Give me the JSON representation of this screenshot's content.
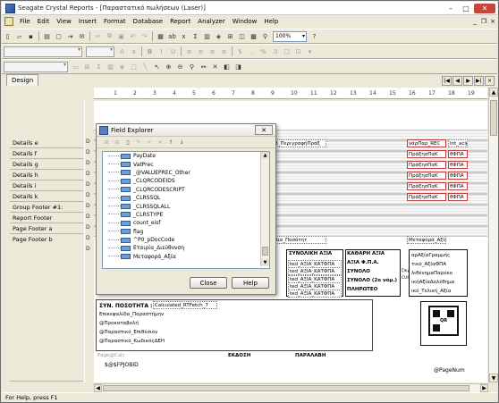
{
  "window": {
    "title": "Seagate Crystal Reports - [Παραστατικό πωλήσεων (Laser)]",
    "min": "–",
    "max": "□",
    "close": "✕"
  },
  "menu": [
    "File",
    "Edit",
    "View",
    "Insert",
    "Format",
    "Database",
    "Report",
    "Analyzer",
    "Window",
    "Help"
  ],
  "mdi": {
    "min": "_",
    "restore": "❐",
    "close": "×"
  },
  "toolbar": {
    "zoom": "100%",
    "icon_names": [
      "new-icon",
      "open-icon",
      "save-icon",
      "print-icon",
      "preview-icon",
      "export-icon",
      "mail-icon",
      "cut-icon",
      "copy-icon",
      "paste-icon",
      "undo-icon",
      "redo-icon",
      "database-icon",
      "text-object-icon",
      "formula-icon",
      "sum-icon",
      "chart-icon",
      "map-icon",
      "subreport-icon",
      "olap-icon",
      "picture-icon",
      "search-icon",
      "zoom-icon",
      "help-icon"
    ]
  },
  "tabs": {
    "design": "Design"
  },
  "tab_nav": {
    "first": "|◀",
    "prev": "◀",
    "next": "▶",
    "last": "▶|",
    "close": "×"
  },
  "sections": [
    "Details e",
    "Details f",
    "Details g",
    "Details h",
    "Details i",
    "Details k",
    "Group Footer #1:",
    "Report Footer",
    "Page Footer a",
    "Page Footer b"
  ],
  "gutter_marks": [
    "D",
    "D",
    "D",
    "D",
    "D",
    "D",
    "D",
    "D",
    "D",
    "D",
    "D"
  ],
  "ruler_ticks": [
    "1",
    "2",
    "3",
    "4",
    "5",
    "6",
    "7",
    "8",
    "9",
    "10",
    "11",
    "12",
    "13",
    "14",
    "15",
    "16",
    "17",
    "18",
    "19"
  ],
  "canvas": {
    "fields_top": [
      "Β_ΠεριγραφήΠράξ",
      "νάρΠαρ_REC",
      "Int_асір",
      "ΠράξησΠαΚ",
      "θΦΠΑ",
      "Δια_Ποσότητ",
      "Μεταφορά_Αξία"
    ],
    "totals_header": "ΣΥΝΟΛΙΚΗ ΑΞΙΑ",
    "totals_cells": [
      "ted_ΑΞΙΑ_ΚΑΤΦΠΑ",
      "ted_ΑΞΙΑ_ΚΑΤΦΠΑ",
      "ted_ΑΞΙΑ_ΚΑΤΦΠΑ",
      "ted_ΑΞΙΑ_ΚΑΤΦΠΑ",
      "ted_ΑΞΙΑ_ΚΑΤΦΠΑ"
    ],
    "labels_right": [
      "ΚΑΘΑΡΗ ΑΞΙΑ",
      "ΑΞΙΑ Φ.Π.Α.",
      "ΣΥΝΟΛΟ",
      "ΣΥΝΟΛΟ (2o νόμ.)",
      "ΠΛΗΡΩΤΕΟ"
    ],
    "side_small": [
      "ζπιρι",
      "CURR"
    ],
    "right_col": [
      "αρΑξίαΓραμμής",
      "τικό_ΑξίαΦΠΑ",
      "λιθένημαΠαρέκο",
      "ικήΑξίαΔολέθημα",
      "ικό_Τελική_Αξία"
    ],
    "qty_label": "ΣΥΝ. ΠΟΣΟΤΗΤΑ :",
    "qty_field": "Calculated_RTFetch_7",
    "footer_lines": [
      "Επικεφαλίδα_Παραστήμην",
      "@Προκαταβολή",
      "@Παραστικό_Επιθέσιον",
      "@Παραστικό_ΚωδικόςΔΕΗ"
    ],
    "page_calc": "Page@Calc",
    "ekdosi": "ΕΚΔΟΣΗ",
    "paralavi": "ΠΑΡΑΛΑΒΗ",
    "sfpjobid": "$@$FPJOBID",
    "page_num": "@PageNum",
    "qr_label": "QR"
  },
  "field_explorer": {
    "title": "Field Explorer",
    "items": [
      "PayDate",
      "VatPrec",
      "_@VALUEPREC_Other",
      "_CLQRCODEIDS",
      "_CLQRCODESCRIPT",
      "_CLRSSQL",
      "_CLRSSQLALL",
      "_CLRSTYPE",
      "count_eisf",
      "flag",
      "^P0_pDocCode",
      "Εταιρία_Διεύθυνση",
      "Μεταφορά_Αξία"
    ],
    "close_label": "Close",
    "help_label": "Help"
  },
  "status": "For Help, press F1"
}
